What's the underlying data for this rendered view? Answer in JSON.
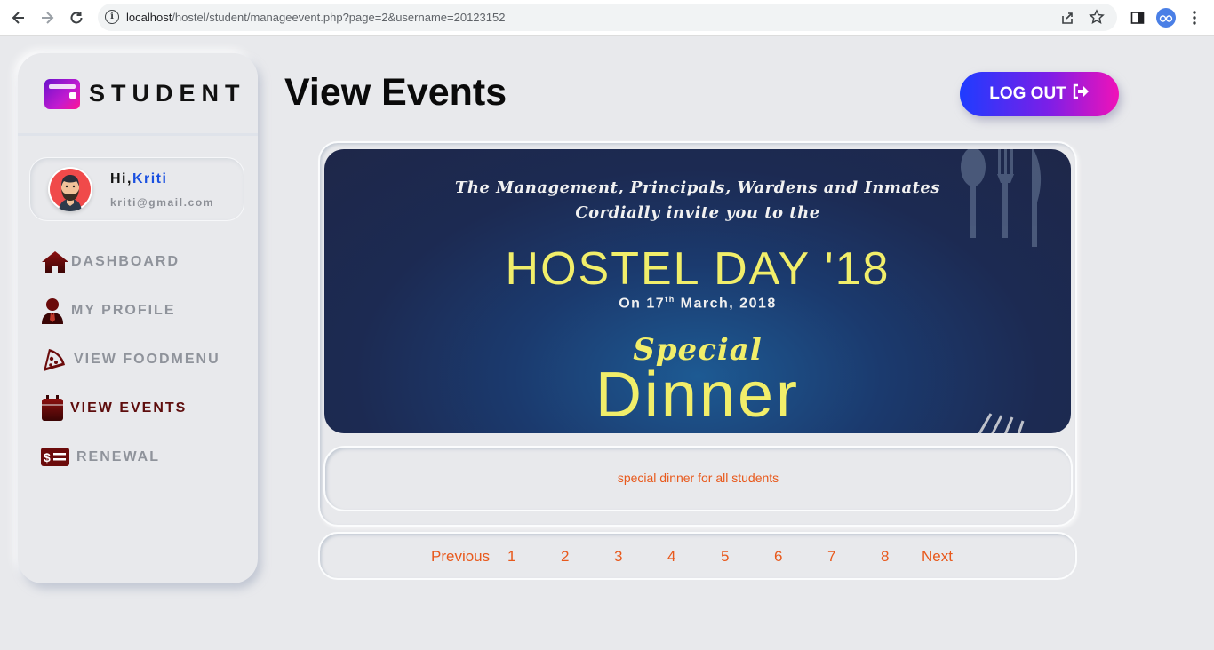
{
  "browser": {
    "url_host": "localhost",
    "url_path": "/hostel/student/manageevent.php?page=2&username=20123152"
  },
  "sidebar": {
    "logo_text": "STUDENT",
    "greeting": "Hi,",
    "user_name": "Kriti",
    "user_email": "kriti@gmail.com",
    "items": [
      {
        "label": "DASHBOARD",
        "icon": "home-icon",
        "active": false
      },
      {
        "label": "MY PROFILE",
        "icon": "user-tie-icon",
        "active": false
      },
      {
        "label": "VIEW FOODMENU",
        "icon": "pizza-slice-icon",
        "active": false
      },
      {
        "label": "VIEW EVENTS",
        "icon": "calendar-icon",
        "active": true
      },
      {
        "label": "RENEWAL",
        "icon": "money-check-icon",
        "active": false
      }
    ]
  },
  "header": {
    "title": "View Events",
    "logout_label": "LOG OUT"
  },
  "event": {
    "banner_line1": "The Management, Principals, Wardens and Inmates",
    "banner_line2": "Cordially invite you to the",
    "banner_title": "HOSTEL DAY '18",
    "banner_date_prefix": "On 17",
    "banner_date_sup": "th",
    "banner_date_suffix": " March, 2018",
    "banner_special": "Special",
    "banner_dinner": "Dinner",
    "description": "special dinner for all students"
  },
  "pagination": {
    "previous": "Previous",
    "pages": [
      "1",
      "2",
      "3",
      "4",
      "5",
      "6",
      "7",
      "8"
    ],
    "next": "Next"
  },
  "colors": {
    "accent_blue": "#1a50e0",
    "active_menu": "#5e0d0d",
    "link_orange": "#e8591c",
    "logout_gradient_start": "#1e3cff",
    "logout_gradient_end": "#f012b8"
  }
}
